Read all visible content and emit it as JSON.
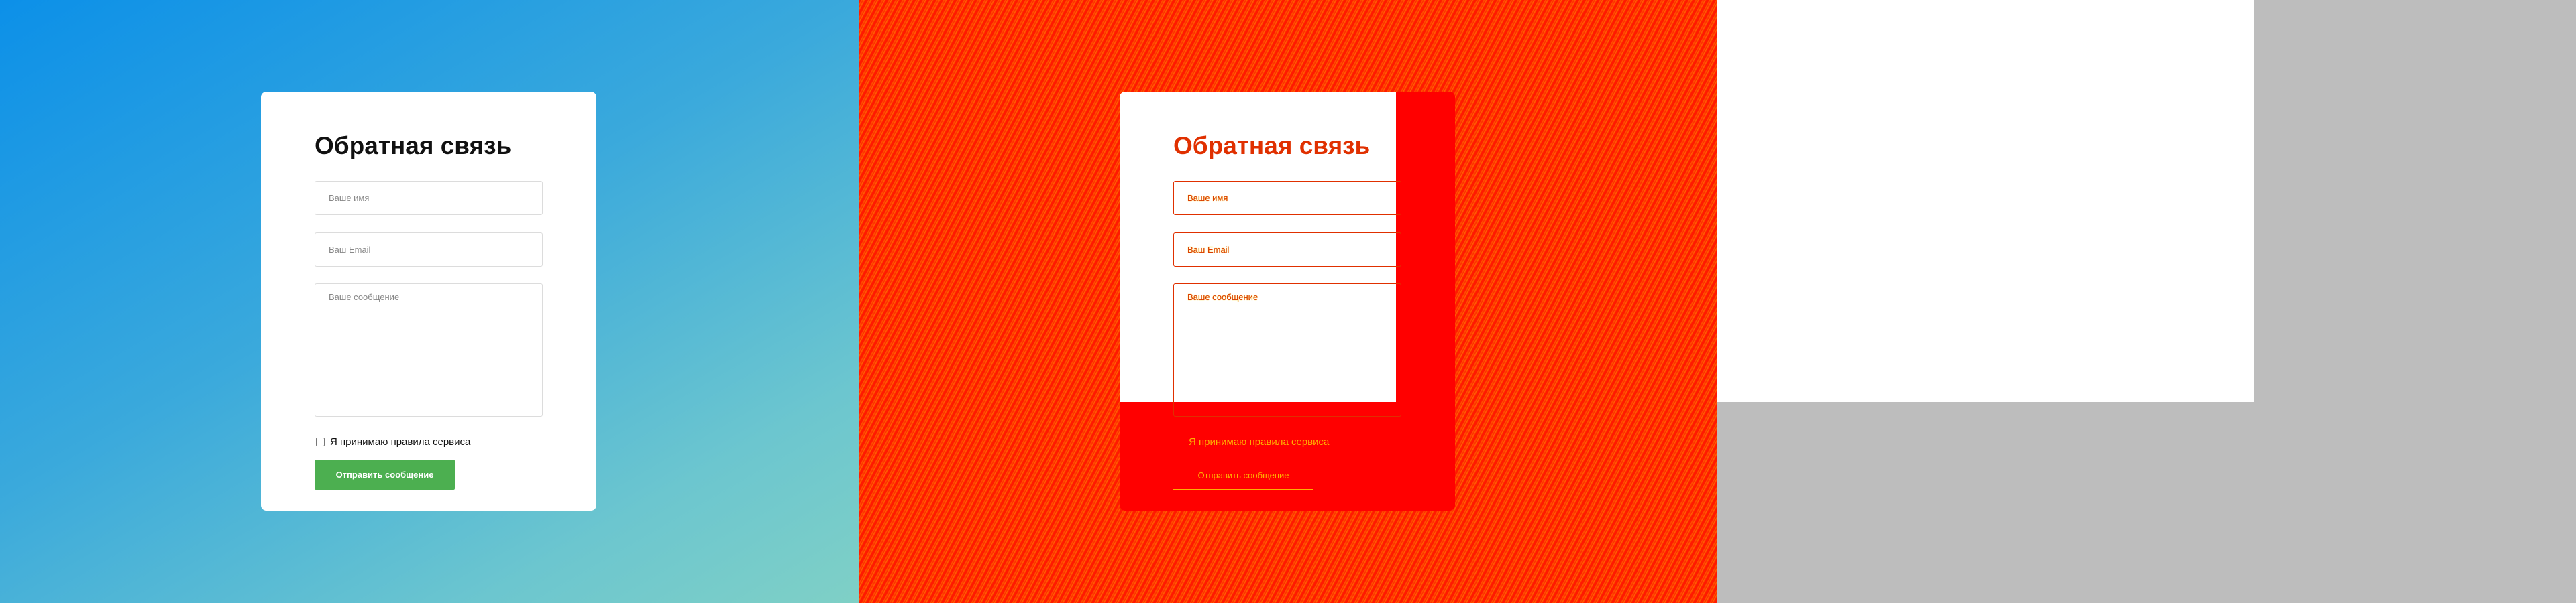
{
  "form": {
    "title": "Обратная связь",
    "name_placeholder": "Ваше имя",
    "email_placeholder": "Ваш Email",
    "message_placeholder": "Ваше  сообщение",
    "agree_label": "Я принимаю правила сервиса",
    "submit_label": "Отправить сообщение"
  },
  "colors": {
    "submit_bg": "#4caf50",
    "gradient_start": "#0c90e8",
    "gradient_end": "#7fd0c6",
    "glitch_red": "#ff0000",
    "glitch_text": "#ffb000"
  }
}
